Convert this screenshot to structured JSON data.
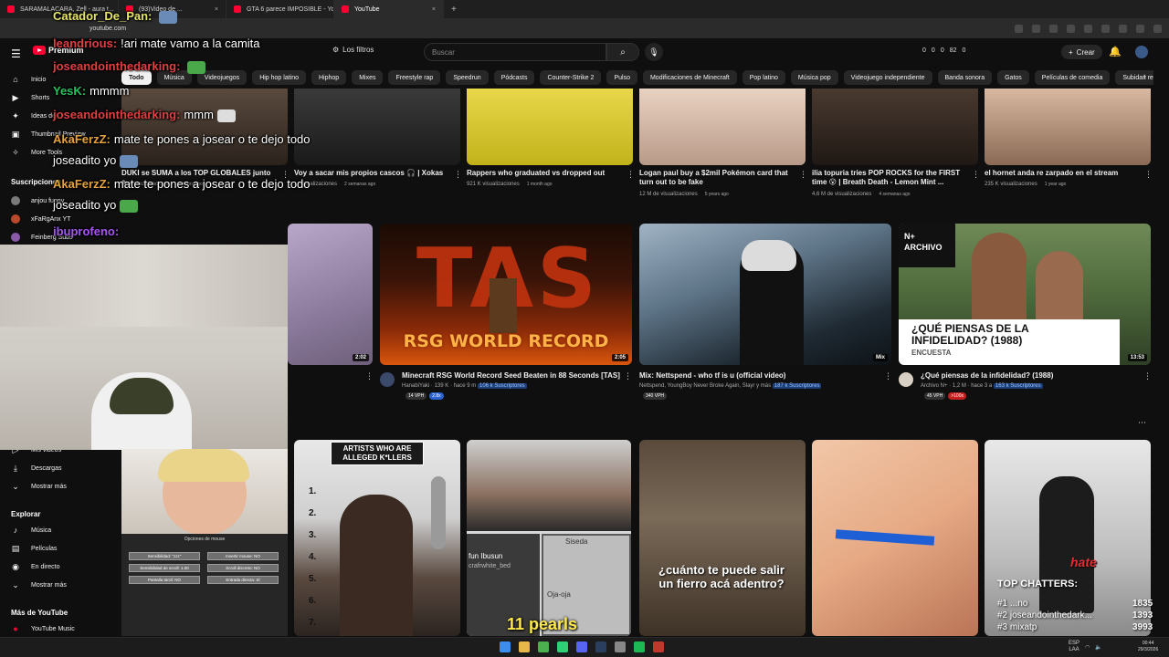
{
  "browser": {
    "tabs": [
      {
        "title": "SARAMALACARA, Zell - aura t...",
        "active": false
      },
      {
        "title": "(93)Video de ...",
        "active": false
      },
      {
        "title": "GTA 6 parece IMPOSIBLE - YouT...",
        "active": false
      },
      {
        "title": "YouTube",
        "active": true
      }
    ],
    "new_tab": "+",
    "url": "youtube.com"
  },
  "youtube": {
    "logo": "Premium",
    "filters_label": "Los filtros",
    "search_placeholder": "Buscar",
    "stats": [
      "0",
      "0",
      "0",
      "82",
      "0"
    ],
    "create_label": "Crear",
    "chips": [
      "Todo",
      "Música",
      "Videojuegos",
      "Hip hop latino",
      "Hiphop",
      "Mixes",
      "Freestyle rap",
      "Speedrun",
      "Pódcasts",
      "Counter-Strike 2",
      "Pulso",
      "Modificaciones de Minecraft",
      "Pop latino",
      "Música pop",
      "Videojuego independiente",
      "Banda sonora",
      "Gatos",
      "Películas de comedia",
      "Subidas recientes",
      "Visto"
    ],
    "sidebar": {
      "top": [
        {
          "label": "Inicio",
          "icon": "home-icon"
        },
        {
          "label": "Shorts",
          "icon": "shorts-icon"
        },
        {
          "label": "Ideas de ...",
          "icon": "ideas-icon"
        },
        {
          "label": "Thumbnail Preview",
          "icon": "thumbnail-icon"
        },
        {
          "label": "More Tools",
          "icon": "tools-icon"
        }
      ],
      "subs_heading": "Suscripciones",
      "subs": [
        {
          "label": "anjou funny",
          "color": "#7a7a7a"
        },
        {
          "label": "xFaRgAnx YT",
          "color": "#b84a2a"
        },
        {
          "label": "Feinberg Subs",
          "color": "#8a5aa8"
        }
      ],
      "you": [
        {
          "label": "Mis videos",
          "icon": "videos-icon"
        },
        {
          "label": "Descargas",
          "icon": "download-icon"
        },
        {
          "label": "Mostrar más",
          "icon": "chevron-down-icon"
        }
      ],
      "explore_heading": "Explorar",
      "explore": [
        {
          "label": "Música",
          "icon": "music-icon"
        },
        {
          "label": "Películas",
          "icon": "movies-icon"
        },
        {
          "label": "En directo",
          "icon": "live-icon"
        },
        {
          "label": "Mostrar más",
          "icon": "chevron-down-icon"
        }
      ],
      "more_heading": "Más de YouTube",
      "more": [
        {
          "label": "YouTube Music",
          "icon": "youtube-music-icon"
        }
      ]
    },
    "row1": [
      {
        "title": "DUKI se SUMA a los TOP GLOBALES junto a ...",
        "meta": "48 K visualizaciones",
        "age": "9 hours ago"
      },
      {
        "title": "Voy a sacar mis propios cascos 🎧 | Xokas",
        "meta": "... visualizaciones",
        "age": "2 semanas ago"
      },
      {
        "title": "Rappers who graduated vs dropped out",
        "meta": "921 K visualizaciones",
        "age": "1 month ago"
      },
      {
        "title": "Logan paul buy a $2mil Pokémon card that turn out to be fake",
        "meta": "12 M de visualizaciones",
        "age": "5 years ago"
      },
      {
        "title": "ilia topuria tries POP ROCKS for the FIRST time 😮 | Breath Death - Lemon Mint ...",
        "meta": "4,6 M de visualizaciones",
        "age": "4 semanas ago"
      },
      {
        "title": "el hornet anda re zarpado en el stream",
        "meta": "235 K visualizaciones",
        "age": "1 year ago"
      }
    ],
    "row2": [
      {
        "title": "",
        "duration": "2:02"
      },
      {
        "title": "Minecraft RSG World Record Seed Beaten in 88 Seconds [TAS]",
        "channel": "HanabiYaki",
        "subs": "139 K",
        "age": "hace 9 m",
        "subs_tag": "106 k Suscriptores",
        "vph": "14 VPH",
        "ratio": "2.8x",
        "duration": "2:05",
        "overlay": "RSG WORLD RECORD",
        "big": "TAS"
      },
      {
        "title": "Mix: Nettspend - who tf is u (official video)",
        "channel": "Nettspend, YoungBoy Never Broke Again, Slayr y más",
        "subs_tag": "187 k Suscriptores",
        "vph": "340 VPH",
        "duration": "Mix"
      },
      {
        "title": "¿Qué piensas de la infidelidad? (1988)",
        "channel": "Archivo N+",
        "subs": "1,2 M",
        "age": "hace 3 a",
        "subs_tag": "163 k Suscriptores",
        "vph": "45 VPH",
        "ratio": ">100x",
        "duration": "13:53",
        "overlay_title": "¿QUÉ PIENSAS DE LA INFIDELIDAD? (1988)",
        "overlay_sub": "ENCUESTA",
        "badge": "N+ ARCHIVO"
      }
    ],
    "row3": [
      {
        "banner": "ARTISTS WHO ARE ALLEGED K*LLERS",
        "numbers": [
          "1.",
          "2.",
          "3.",
          "4.",
          "5.",
          "6.",
          "7."
        ]
      },
      {
        "labels": [
          "Siseda",
          "fun Ibusun",
          "crafrwhite_bed",
          "Oja-oja"
        ]
      },
      {
        "caption": "¿cuánto te puede salir un fierro acá adentro?"
      },
      {},
      {
        "word": "hate"
      }
    ]
  },
  "chat": [
    {
      "user": "Catador_De_Pan:",
      "msg": "",
      "color": "#e6e66a"
    },
    {
      "user": "leandrious:",
      "msg": "!ari mate vamo a la camita",
      "color": "#e04040"
    },
    {
      "user": "joseandointhedarking:",
      "msg": "",
      "color": "#e04040"
    },
    {
      "user": "YesK:",
      "msg": "mmmm",
      "color": "#22c55e"
    },
    {
      "user": "joseandointhedarking:",
      "msg": "mmm",
      "color": "#e04040"
    },
    {
      "user": "AkaFerzZ:",
      "msg": "mate te pones a josear o te dejo todo",
      "color": "#e6a23c"
    },
    {
      "user": "",
      "msg": "joseadito yo",
      "color": "#ffffff"
    },
    {
      "user": "AkaFerzZ:",
      "msg": "mate te pones a josear o te dejo todo",
      "color": "#e6a23c"
    },
    {
      "user": "",
      "msg": "joseadito yo",
      "color": "#ffffff"
    },
    {
      "user": "ibuprofeno:",
      "msg": "",
      "color": "#a855f7"
    }
  ],
  "game_menu": {
    "title": "Opciones de mouse",
    "options": [
      "Sensibilidad: \"zzz\"",
      "Invertir mouse: NO",
      "Sensibilidad de scroll: 1.00",
      "Scroll discreto: NO",
      "Pantalla táctil: NO",
      "Entrada directa: SÍ"
    ]
  },
  "subtitle": "11 pearls",
  "top_chatters": {
    "heading": "TOP CHATTERS:",
    "items": [
      {
        "name": "#1 ...no",
        "count": "1835"
      },
      {
        "name": "#2 joseandointhedark...",
        "count": "1393"
      },
      {
        "name": "#3 mixatp",
        "count": "3993"
      }
    ]
  },
  "taskbar": {
    "lang": "ESP",
    "lang2": "LAA",
    "time": "00:44",
    "date": "29/3/2026"
  }
}
